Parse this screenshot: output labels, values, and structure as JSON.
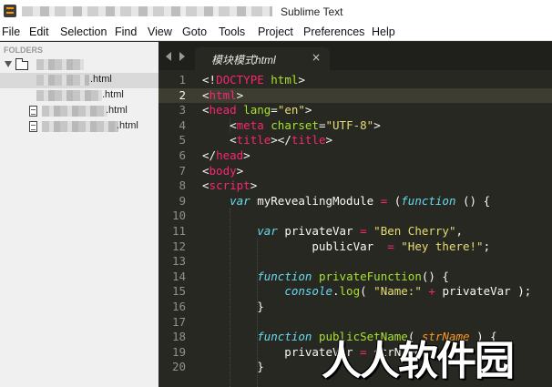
{
  "window": {
    "title": "Sublime Text"
  },
  "menu": [
    "File",
    "Edit",
    "Selection",
    "Find",
    "View",
    "Goto",
    "Tools",
    "Project",
    "Preferences",
    "Help"
  ],
  "sidebar": {
    "heading": "FOLDERS",
    "files": [
      ".html",
      ".html",
      ".html",
      ".html"
    ]
  },
  "tab": {
    "label": "模块模式html",
    "close": "×"
  },
  "editor": {
    "current_line": 2,
    "line_numbers": [
      "1",
      "2",
      "3",
      "4",
      "5",
      "6",
      "7",
      "8",
      "9",
      "10",
      "11",
      "12",
      "13",
      "14",
      "15",
      "16",
      "17",
      "18",
      "19",
      "20"
    ]
  },
  "watermark": "人人软件园"
}
